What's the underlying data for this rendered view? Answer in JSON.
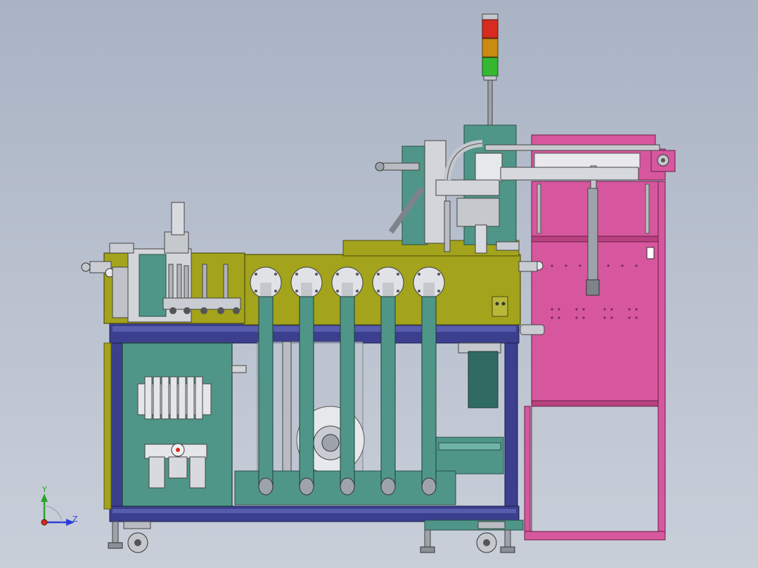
{
  "triad": {
    "y_label": "Y",
    "z_label": "Z"
  },
  "colors": {
    "background_top": "#a9b3c4",
    "background_bottom": "#c9cfd9",
    "olive_panel": "#a3a31c",
    "teal": "#4f9688",
    "teal_dark": "#2f6b63",
    "magenta": "#d6579e",
    "frame_navy": "#3b3f8e",
    "steel": "#b9bcc2",
    "light_red": "#d62b1e",
    "light_amber": "#c98b10",
    "light_green": "#35b82f",
    "axis_y": "#2aa52a",
    "axis_z": "#2a3fd6"
  },
  "icons": {
    "signal_tower": "stack-light-icon",
    "fan": "fan-icon",
    "caster": "caster-wheel-icon"
  }
}
